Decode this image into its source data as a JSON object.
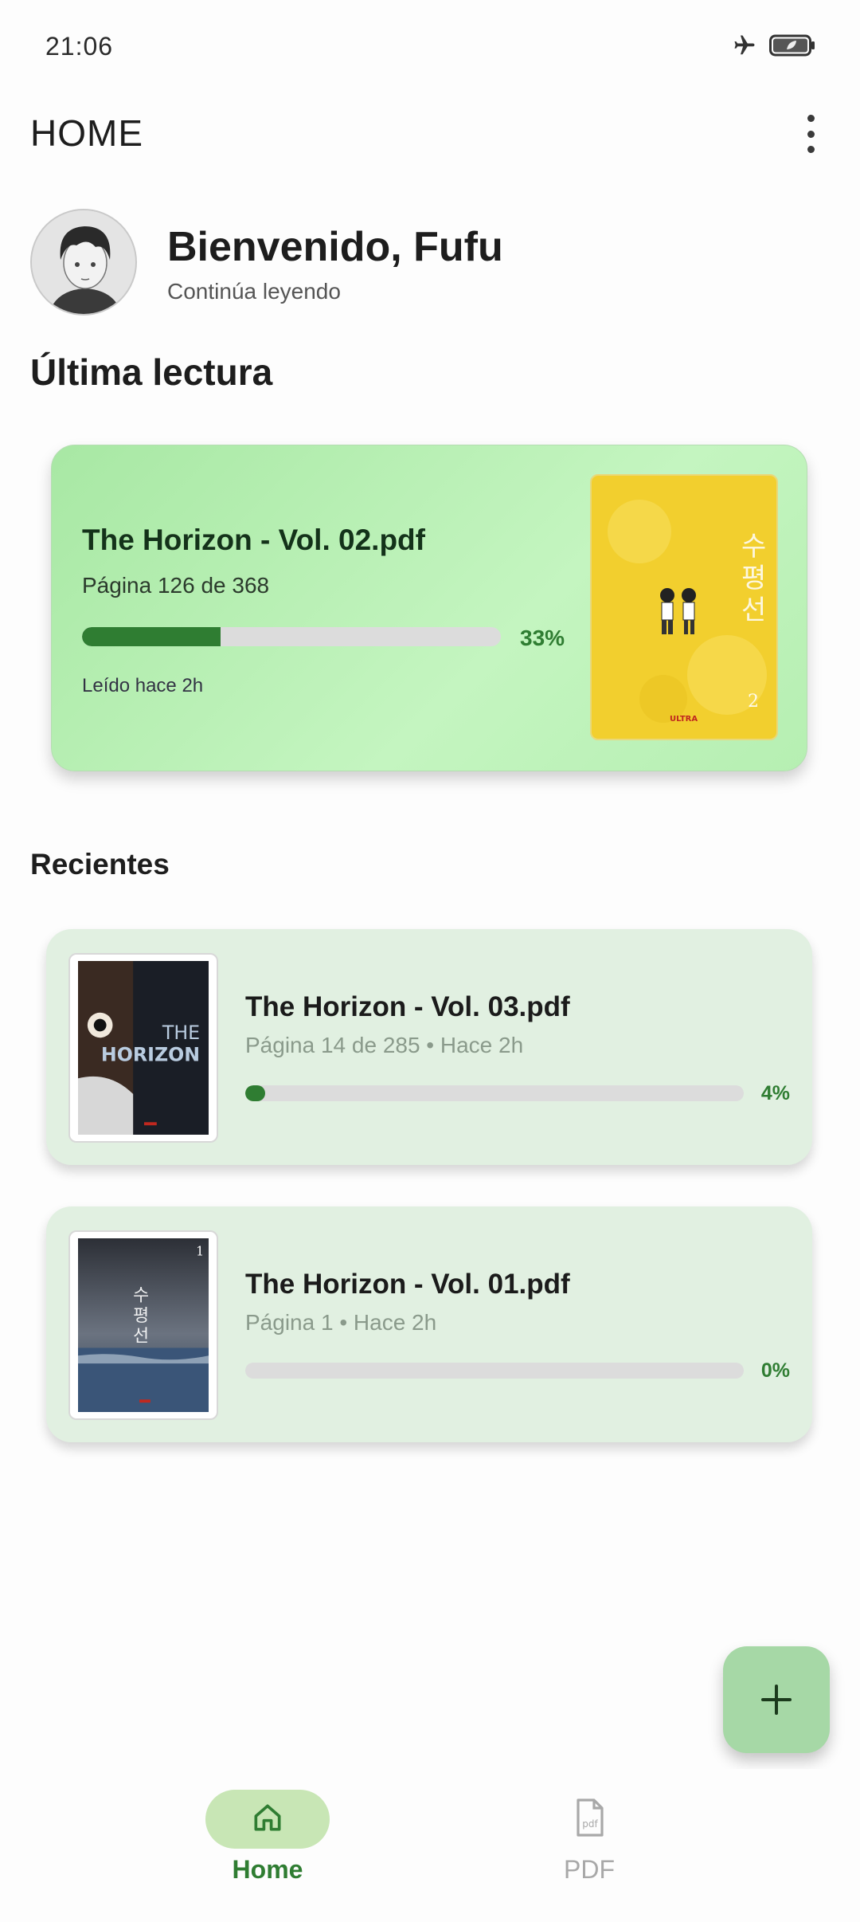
{
  "status_bar": {
    "time": "21:06",
    "icons": [
      "airplane-icon",
      "battery-saver-icon"
    ]
  },
  "app_bar": {
    "title": "HOME",
    "menu_icon": "more-vert-icon"
  },
  "profile": {
    "greeting": "Bienvenido, Fufu",
    "subtitle": "Continúa leyendo"
  },
  "last_read": {
    "section_title": "Última lectura",
    "file_name": "The Horizon - Vol. 02.pdf",
    "page_text": "Página 126 de 368",
    "progress": 0.33,
    "progress_label": "33%",
    "read_time": "Leído hace 2h"
  },
  "recents": {
    "section_title": "Recientes",
    "items": [
      {
        "file_name": "The Horizon - Vol. 03.pdf",
        "meta": "Página 14 de 285 • Hace 2h",
        "progress": 0.04,
        "progress_label": "4%"
      },
      {
        "file_name": "The Horizon - Vol. 01.pdf",
        "meta": "Página 1 • Hace 2h",
        "progress": 0.0,
        "progress_label": "0%"
      }
    ]
  },
  "cover_texts": {
    "vol2_number": "2",
    "vol2_publisher": "ULTRA",
    "vol3_title_line1": "THE",
    "vol3_title_line2": "HORIZON",
    "vol1_number": "1"
  },
  "fab": {
    "icon": "plus-icon"
  },
  "bottom_nav": {
    "items": [
      {
        "label": "Home",
        "icon": "home-icon",
        "active": true
      },
      {
        "label": "PDF",
        "icon": "pdf-file-icon",
        "active": false
      }
    ]
  },
  "colors": {
    "accent": "#2f7d32",
    "featured_card": "#b6efb2",
    "recent_card": "#e1f0e1",
    "fab": "#a6d8a6",
    "nav_active_pill": "#c8e6b5"
  }
}
